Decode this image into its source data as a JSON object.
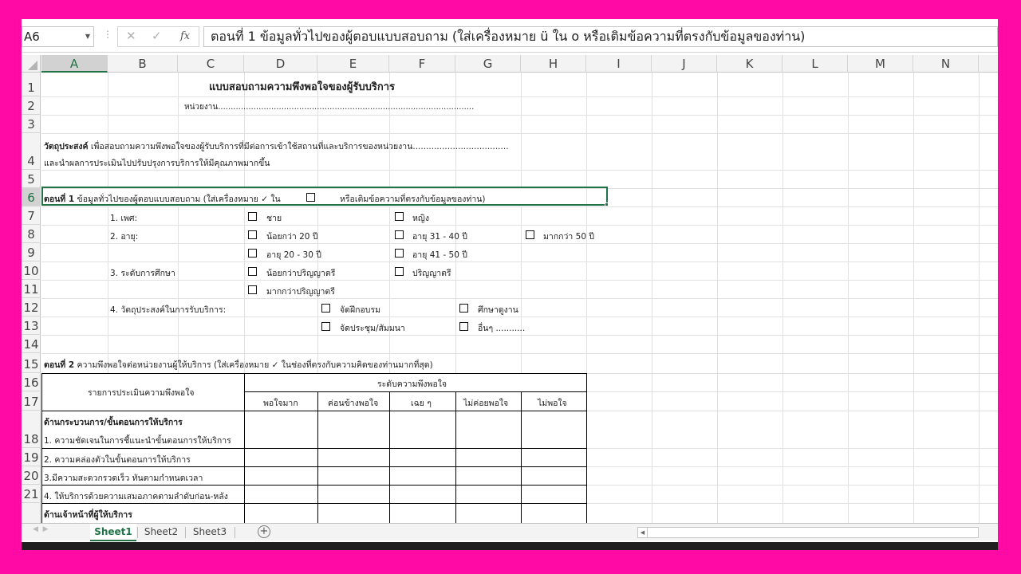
{
  "formula_bar": {
    "name_box": "A6",
    "cancel_icon": "✕",
    "enter_icon": "✓",
    "fx_label": "fx",
    "content": "ตอนที่ 1  ข้อมูลทั่วไปของผู้ตอบแบบสอบถาม (ใส่เครื่องหมาย ü  ใน  o หรือเติมข้อความที่ตรงกับข้อมูลของท่าน)"
  },
  "columns": [
    "A",
    "B",
    "C",
    "D",
    "E",
    "F",
    "G",
    "H",
    "I",
    "J",
    "K",
    "L",
    "M",
    "N"
  ],
  "selected_column": "A",
  "rows": [
    "1",
    "2",
    "3",
    "4",
    "5",
    "6",
    "7",
    "8",
    "9",
    "10",
    "11",
    "12",
    "13",
    "14",
    "15",
    "16",
    "17",
    "18",
    "19",
    "20",
    "21",
    ""
  ],
  "selected_row": "6",
  "sheet": {
    "title": "แบบสอบถามความพึงพอใจของผู้รับบริการ",
    "unit": "หน่วยงาน.....................................................................................................",
    "objective_label": "วัตถุประสงค์",
    "objective_text": " เพื่อสอบถามความพึงพอใจของผู้รับบริการที่มีต่อการเข้าใช้สถานที่และบริการของหน่วยงาน....................................",
    "objective_text2": "และนำผลการประเมินไปปรับปรุงการบริการให้มีคุณภาพมากขึ้น",
    "part1_label": "ตอนที่ 1",
    "part1_text": "  ข้อมูลทั่วไปของผู้ตอบแบบสอบถาม (ใส่เครื่องหมาย ✓  ใน ",
    "part1_text2": "หรือเติมข้อความที่ตรงกับข้อมูลของท่าน)",
    "q1": "1. เพศ:",
    "male": "ชาย",
    "female": "หญิง",
    "q2": "2. อายุ:",
    "age_lt20": "น้อยกว่า  20 ปี",
    "age_31_40": "อายุ 31 - 40 ปี",
    "age_gt50": "มากกว่า  50 ปี",
    "age_20_30": "อายุ 20 - 30 ปี",
    "age_41_50": "อายุ 41 - 50 ปี",
    "q3": "3. ระดับการศึกษา",
    "edu_lt_bachelor": "น้อยกว่าปริญญาตรี",
    "edu_bachelor": "ปริญญาตรี",
    "edu_gt_bachelor": "มากกว่าปริญญาตรี",
    "q4": "4. วัตถุประสงค์ในการรับบริการ:",
    "obj_training": "จัดฝึกอบรม",
    "obj_study": "ศึกษาดูงาน",
    "obj_meeting": "จัดประชุม/สัมมนา",
    "obj_other": "อื่นๆ ...........",
    "part2_label": "ตอนที่ 2",
    "part2_text": "  ความพึงพอใจต่อหน่วยงานผู้ให้บริการ (ใส่เครื่องหมาย ✓ ในช่องที่ตรงกับความคิดของท่านมากที่สุด)",
    "table_item_header": "รายการประเมินความพึงพอใจ",
    "table_level_header": "ระดับความพึงพอใจ",
    "levels": [
      "พอใจมาก",
      "ค่อนข้างพอใจ",
      "เฉย ๆ",
      "ไม่ค่อยพอใจ",
      "ไม่พอใจ"
    ],
    "section1": "ด้านกระบวนการ/ขั้นตอนการให้บริการ",
    "items": [
      "1. ความชัดเจนในการชี้แนะนำขั้นตอนการให้บริการ",
      "2. ความคล่องตัวในขั้นตอนการให้บริการ",
      "3.มีความสะดวกรวดเร็ว ทันตามกำหนดเวลา",
      "4. ให้บริการด้วยความเสมอภาคตามลำดับก่อน-หลัง"
    ],
    "section2": "ด้านเจ้าหน้าที่ผู้ให้บริการ"
  },
  "tabs": {
    "sheet1": "Sheet1",
    "sheet2": "Sheet2",
    "sheet3": "Sheet3",
    "add": "+"
  },
  "colors": {
    "border": "#ff0aa5",
    "excel_green": "#217346"
  }
}
